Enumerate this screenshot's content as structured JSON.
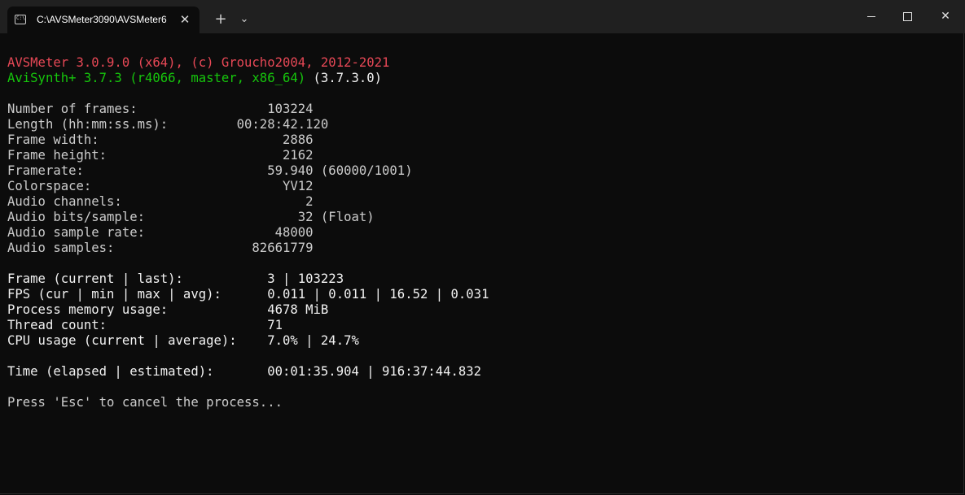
{
  "tab": {
    "title": "C:\\AVSMeter3090\\AVSMeter6",
    "icon": "terminal-icon",
    "close_glyph": "✕"
  },
  "tab_controls": {
    "new_tab_glyph": "+",
    "dropdown_glyph": "⌄"
  },
  "window_controls": {
    "close_glyph": "✕"
  },
  "colors": {
    "background": "#0c0c0c",
    "titlebar": "#202020",
    "red_text": "#e74856",
    "green_text": "#16c60c",
    "normal_text": "#cccccc",
    "bright_text": "#f2f2f2"
  },
  "terminal": {
    "header_line1": "AVSMeter 3.0.9.0 (x64), (c) Groucho2004, 2012-2021",
    "header_line2_green": "AviSynth+ 3.7.3 (r4066, master, x86_64)",
    "header_line2_version": " (3.7.3.0)",
    "info_lines": [
      "Number of frames:                 103224",
      "Length (hh:mm:ss.ms):         00:28:42.120",
      "Frame width:                        2886",
      "Frame height:                       2162",
      "Framerate:                        59.940 (60000/1001)",
      "Colorspace:                         YV12",
      "Audio channels:                        2",
      "Audio bits/sample:                    32 (Float)",
      "Audio sample rate:                 48000",
      "Audio samples:                  82661779"
    ],
    "stats_lines": [
      "Frame (current | last):           3 | 103223",
      "FPS (cur | min | max | avg):      0.011 | 0.011 | 16.52 | 0.031",
      "Process memory usage:             4678 MiB",
      "Thread count:                     71",
      "CPU usage (current | average):    7.0% | 24.7%"
    ],
    "time_line": "Time (elapsed | estimated):       00:01:35.904 | 916:37:44.832",
    "prompt_line": "Press 'Esc' to cancel the process..."
  }
}
